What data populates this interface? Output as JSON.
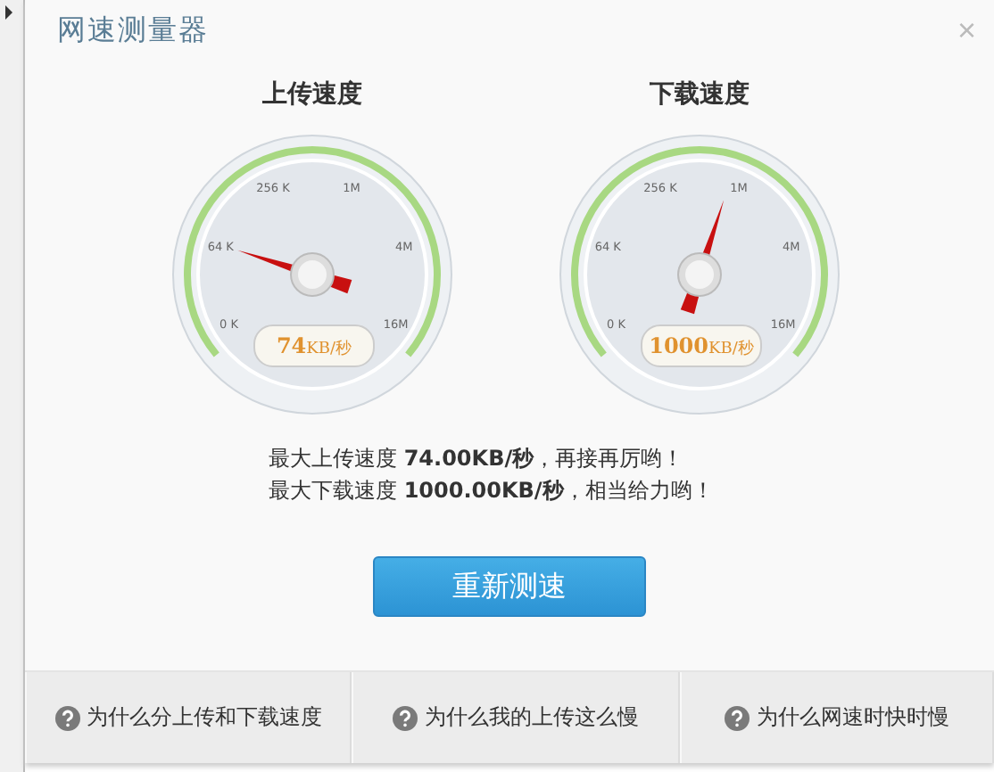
{
  "window": {
    "title": "网速测量器",
    "close": "×"
  },
  "gauges": [
    {
      "title": "上传速度",
      "value": "74",
      "unit": "KB/秒",
      "ticks": [
        "0 K",
        "64 K",
        "256 K",
        "1M",
        "4M",
        "16M"
      ]
    },
    {
      "title": "下载速度",
      "value": "1000",
      "unit": "KB/秒",
      "ticks": [
        "0 K",
        "64 K",
        "256 K",
        "1M",
        "4M",
        "16M"
      ]
    }
  ],
  "summary": [
    "最大上传速度 **74.00KB/秒**，再接再厉哟！",
    "最大下载速度 **1000.00KB/秒**，相当给力哟！"
  ],
  "retest_button": "重新测速",
  "help_links": [
    "为什么分上传和下载速度",
    "为什么我的上传这么慢",
    "为什么网速时快时慢"
  ]
}
